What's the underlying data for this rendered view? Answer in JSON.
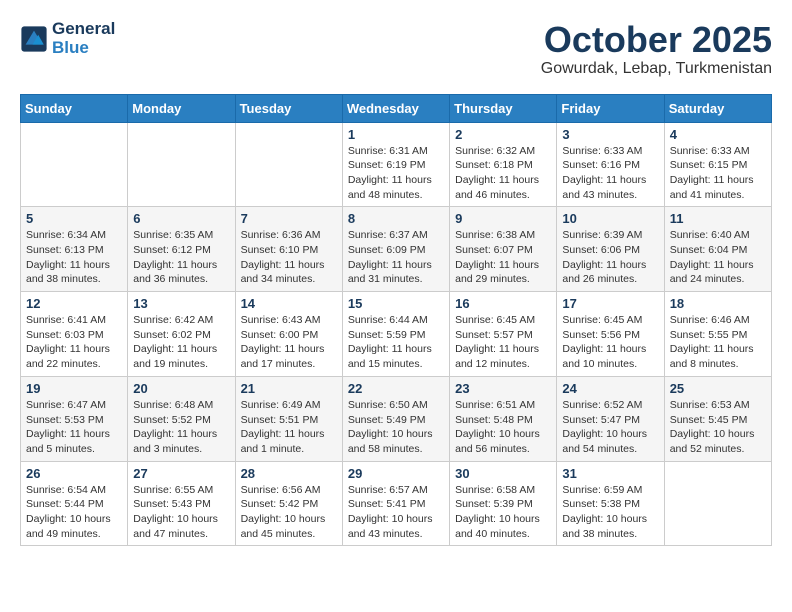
{
  "header": {
    "logo_line1": "General",
    "logo_line2": "Blue",
    "month": "October 2025",
    "location": "Gowurdak, Lebap, Turkmenistan"
  },
  "weekdays": [
    "Sunday",
    "Monday",
    "Tuesday",
    "Wednesday",
    "Thursday",
    "Friday",
    "Saturday"
  ],
  "weeks": [
    [
      {
        "day": "",
        "info": ""
      },
      {
        "day": "",
        "info": ""
      },
      {
        "day": "",
        "info": ""
      },
      {
        "day": "1",
        "info": "Sunrise: 6:31 AM\nSunset: 6:19 PM\nDaylight: 11 hours\nand 48 minutes."
      },
      {
        "day": "2",
        "info": "Sunrise: 6:32 AM\nSunset: 6:18 PM\nDaylight: 11 hours\nand 46 minutes."
      },
      {
        "day": "3",
        "info": "Sunrise: 6:33 AM\nSunset: 6:16 PM\nDaylight: 11 hours\nand 43 minutes."
      },
      {
        "day": "4",
        "info": "Sunrise: 6:33 AM\nSunset: 6:15 PM\nDaylight: 11 hours\nand 41 minutes."
      }
    ],
    [
      {
        "day": "5",
        "info": "Sunrise: 6:34 AM\nSunset: 6:13 PM\nDaylight: 11 hours\nand 38 minutes."
      },
      {
        "day": "6",
        "info": "Sunrise: 6:35 AM\nSunset: 6:12 PM\nDaylight: 11 hours\nand 36 minutes."
      },
      {
        "day": "7",
        "info": "Sunrise: 6:36 AM\nSunset: 6:10 PM\nDaylight: 11 hours\nand 34 minutes."
      },
      {
        "day": "8",
        "info": "Sunrise: 6:37 AM\nSunset: 6:09 PM\nDaylight: 11 hours\nand 31 minutes."
      },
      {
        "day": "9",
        "info": "Sunrise: 6:38 AM\nSunset: 6:07 PM\nDaylight: 11 hours\nand 29 minutes."
      },
      {
        "day": "10",
        "info": "Sunrise: 6:39 AM\nSunset: 6:06 PM\nDaylight: 11 hours\nand 26 minutes."
      },
      {
        "day": "11",
        "info": "Sunrise: 6:40 AM\nSunset: 6:04 PM\nDaylight: 11 hours\nand 24 minutes."
      }
    ],
    [
      {
        "day": "12",
        "info": "Sunrise: 6:41 AM\nSunset: 6:03 PM\nDaylight: 11 hours\nand 22 minutes."
      },
      {
        "day": "13",
        "info": "Sunrise: 6:42 AM\nSunset: 6:02 PM\nDaylight: 11 hours\nand 19 minutes."
      },
      {
        "day": "14",
        "info": "Sunrise: 6:43 AM\nSunset: 6:00 PM\nDaylight: 11 hours\nand 17 minutes."
      },
      {
        "day": "15",
        "info": "Sunrise: 6:44 AM\nSunset: 5:59 PM\nDaylight: 11 hours\nand 15 minutes."
      },
      {
        "day": "16",
        "info": "Sunrise: 6:45 AM\nSunset: 5:57 PM\nDaylight: 11 hours\nand 12 minutes."
      },
      {
        "day": "17",
        "info": "Sunrise: 6:45 AM\nSunset: 5:56 PM\nDaylight: 11 hours\nand 10 minutes."
      },
      {
        "day": "18",
        "info": "Sunrise: 6:46 AM\nSunset: 5:55 PM\nDaylight: 11 hours\nand 8 minutes."
      }
    ],
    [
      {
        "day": "19",
        "info": "Sunrise: 6:47 AM\nSunset: 5:53 PM\nDaylight: 11 hours\nand 5 minutes."
      },
      {
        "day": "20",
        "info": "Sunrise: 6:48 AM\nSunset: 5:52 PM\nDaylight: 11 hours\nand 3 minutes."
      },
      {
        "day": "21",
        "info": "Sunrise: 6:49 AM\nSunset: 5:51 PM\nDaylight: 11 hours\nand 1 minute."
      },
      {
        "day": "22",
        "info": "Sunrise: 6:50 AM\nSunset: 5:49 PM\nDaylight: 10 hours\nand 58 minutes."
      },
      {
        "day": "23",
        "info": "Sunrise: 6:51 AM\nSunset: 5:48 PM\nDaylight: 10 hours\nand 56 minutes."
      },
      {
        "day": "24",
        "info": "Sunrise: 6:52 AM\nSunset: 5:47 PM\nDaylight: 10 hours\nand 54 minutes."
      },
      {
        "day": "25",
        "info": "Sunrise: 6:53 AM\nSunset: 5:45 PM\nDaylight: 10 hours\nand 52 minutes."
      }
    ],
    [
      {
        "day": "26",
        "info": "Sunrise: 6:54 AM\nSunset: 5:44 PM\nDaylight: 10 hours\nand 49 minutes."
      },
      {
        "day": "27",
        "info": "Sunrise: 6:55 AM\nSunset: 5:43 PM\nDaylight: 10 hours\nand 47 minutes."
      },
      {
        "day": "28",
        "info": "Sunrise: 6:56 AM\nSunset: 5:42 PM\nDaylight: 10 hours\nand 45 minutes."
      },
      {
        "day": "29",
        "info": "Sunrise: 6:57 AM\nSunset: 5:41 PM\nDaylight: 10 hours\nand 43 minutes."
      },
      {
        "day": "30",
        "info": "Sunrise: 6:58 AM\nSunset: 5:39 PM\nDaylight: 10 hours\nand 40 minutes."
      },
      {
        "day": "31",
        "info": "Sunrise: 6:59 AM\nSunset: 5:38 PM\nDaylight: 10 hours\nand 38 minutes."
      },
      {
        "day": "",
        "info": ""
      }
    ]
  ]
}
